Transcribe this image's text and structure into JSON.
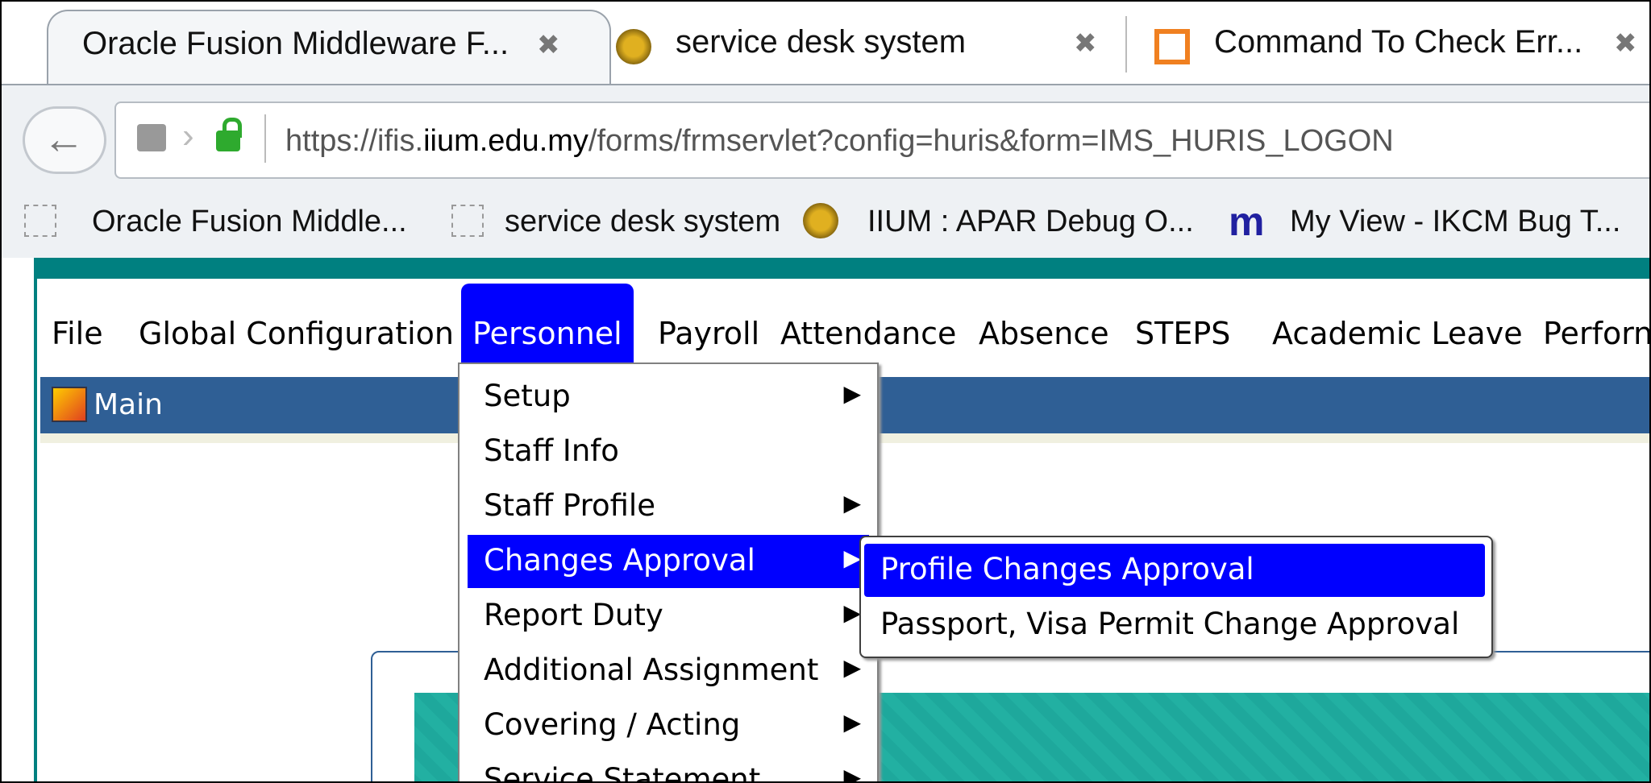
{
  "tabs": [
    {
      "title": "Oracle Fusion Middleware F...",
      "close": "✖"
    },
    {
      "title": "service desk system",
      "close": "✖"
    },
    {
      "title": "Command To Check Err...",
      "close": "✖"
    }
  ],
  "address": {
    "prefix": "https://ifis.",
    "domain": "iium.edu.my",
    "path": "/forms/frmservlet?config=huris&form=IMS_HURIS_LOGON"
  },
  "bookmarks": [
    {
      "label": "Oracle Fusion Middle..."
    },
    {
      "label": "service desk system"
    },
    {
      "label": "IIUM : APAR Debug O..."
    },
    {
      "label": "My View - IKCM Bug T..."
    }
  ],
  "menubar": [
    {
      "label": "File"
    },
    {
      "label": "Global Configuration"
    },
    {
      "label": "Personnel"
    },
    {
      "label": "Payroll"
    },
    {
      "label": "Attendance"
    },
    {
      "label": "Absence"
    },
    {
      "label": "STEPS"
    },
    {
      "label": "Academic Leave"
    },
    {
      "label": "Perforn"
    }
  ],
  "main_window": {
    "title": "Main"
  },
  "personnel_menu": [
    {
      "label": "Setup",
      "has_submenu": true
    },
    {
      "label": "Staff Info",
      "has_submenu": false
    },
    {
      "label": "Staff Profile",
      "has_submenu": true
    },
    {
      "label": "Changes Approval",
      "has_submenu": true,
      "selected": true
    },
    {
      "label": "Report Duty",
      "has_submenu": true
    },
    {
      "label": "Additional Assignment",
      "has_submenu": true
    },
    {
      "label": "Covering / Acting",
      "has_submenu": true
    },
    {
      "label": "Service Statement",
      "has_submenu": true
    }
  ],
  "changes_approval_submenu": [
    {
      "label": "Profile Changes Approval",
      "selected": true
    },
    {
      "label": "Passport, Visa  Permit Change Approval"
    }
  ],
  "colors": {
    "selection": "#0000ff",
    "app_header": "#008080",
    "main_titlebar": "#2f5f95"
  }
}
